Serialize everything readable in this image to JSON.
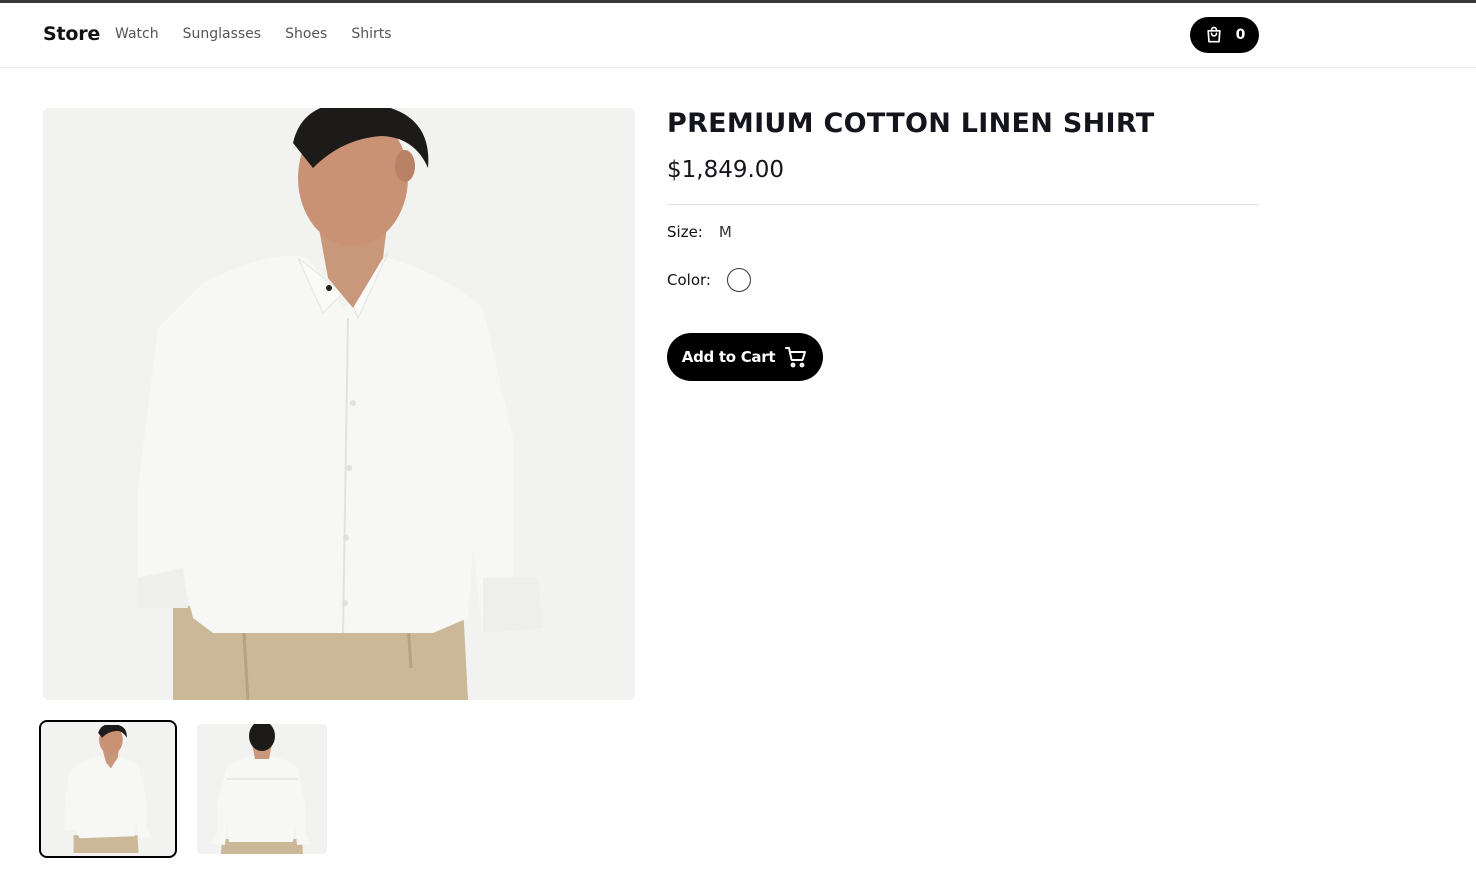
{
  "nav": {
    "brand": "Store",
    "links": [
      "Watch",
      "Sunglasses",
      "Shoes",
      "Shirts"
    ],
    "cart_icon": "shopping-bag-icon",
    "cart_count": "0"
  },
  "product": {
    "title": "PREMIUM COTTON LINEN SHIRT",
    "price": "$1,849.00",
    "size_label": "Size:",
    "size_value": "M",
    "color_label": "Color:",
    "color_swatch": "#ffffff",
    "add_to_cart_label": "Add to Cart",
    "add_to_cart_icon": "shopping-cart-icon"
  },
  "gallery": {
    "main_image": "model-front-view",
    "thumbnails": [
      "front-view",
      "back-view"
    ],
    "selected_index": 0
  },
  "colors": {
    "primary": "#000000",
    "text": "#14141c",
    "shirt": "#f4f4f2",
    "trousers": "#cbb898"
  }
}
